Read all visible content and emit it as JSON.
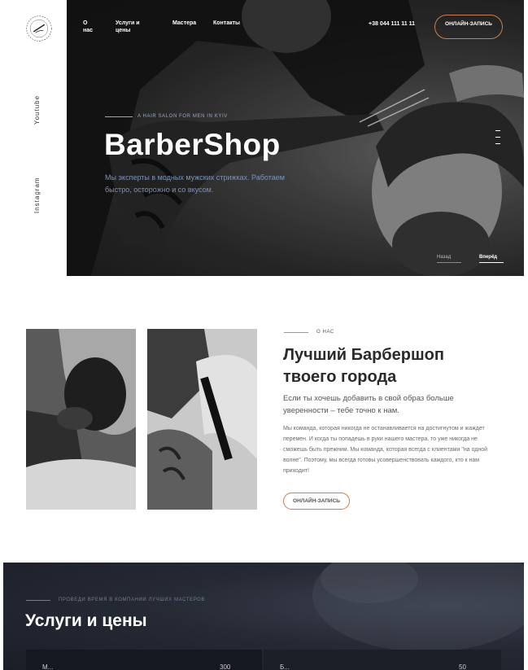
{
  "header": {
    "logo_text": "GALLERY • STORE • BARBER",
    "nav": [
      "О нас",
      "Услуги и цены",
      "Мастера",
      "Контакты"
    ],
    "phone": "+38 044 111 11 11",
    "cta": "ОНЛАЙН-ЗАПИСЬ"
  },
  "social": [
    "Youtube",
    "Instagram"
  ],
  "hero": {
    "tagline": "A HAIR SALON FOR MEN IN KYIV",
    "title": "BarberShop",
    "description": "Мы эксперты в модных мужских стрижках. Работаем быстро, осторожно и со вкусом.",
    "prev": "Назад",
    "next": "Вперёд"
  },
  "about": {
    "tag": "О НАС",
    "title": "Лучший Барбершоп твоего города",
    "lead": "Если ты хочешь добавить в свой образ больше уверенности – тебе точно к нам.",
    "body": "Мы команда, которая никогда не останавливается на достигнутом и жаждет перемен. И когда ты попадешь в руки нашего мастера, то уже никогда не сможешь быть прежним. Мы команда, которая всегда с клиентами \"на одной волне\". Поэтому, мы всегда готовы усовершенствовать каждого, кто к нам приходит!",
    "cta": "ОНЛАЙН-ЗАПИСЬ"
  },
  "services": {
    "tag": "ПРОВЕДИ ВРЕМЯ В КОМПАНИИ ЛУЧШИХ МАСТЕРОВ",
    "title": "Услуги и цены",
    "rows": [
      {
        "name": "М...",
        "price": "300"
      },
      {
        "name": "Б...",
        "price": "50"
      }
    ]
  },
  "colors": {
    "accent": "#c87f50",
    "muted_blue": "#7f93b3",
    "dark_bg": "#1b1e27"
  }
}
